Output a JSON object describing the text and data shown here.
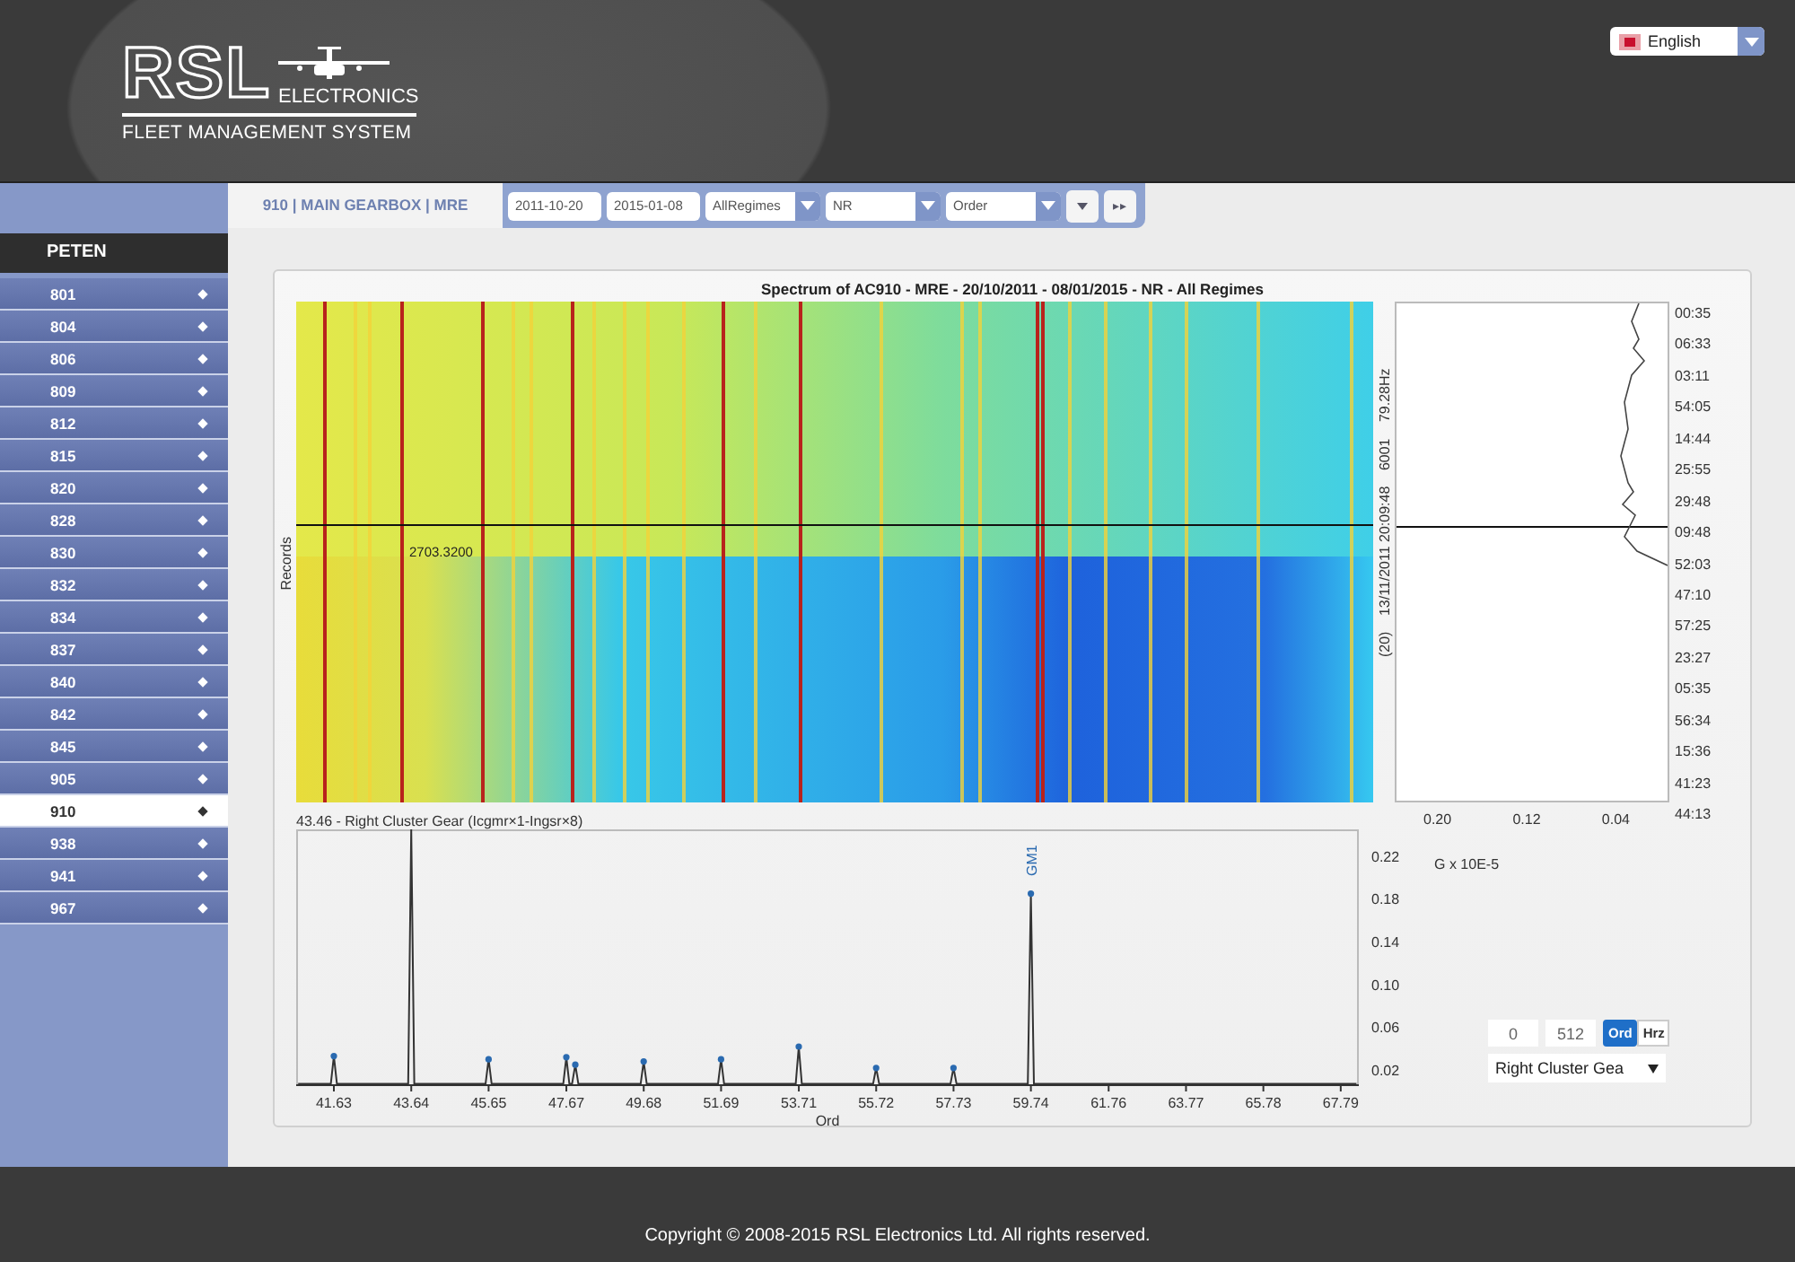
{
  "header": {
    "logo_text": "RSL",
    "logo_subtitle": "ELECTRONICS",
    "system_name": "FLEET MANAGEMENT SYSTEM",
    "language": "English"
  },
  "sidebar": {
    "title": "PETEN",
    "items": [
      {
        "label": "801",
        "selected": false
      },
      {
        "label": "804",
        "selected": false
      },
      {
        "label": "806",
        "selected": false
      },
      {
        "label": "809",
        "selected": false
      },
      {
        "label": "812",
        "selected": false
      },
      {
        "label": "815",
        "selected": false
      },
      {
        "label": "820",
        "selected": false
      },
      {
        "label": "828",
        "selected": false
      },
      {
        "label": "830",
        "selected": false
      },
      {
        "label": "832",
        "selected": false
      },
      {
        "label": "834",
        "selected": false
      },
      {
        "label": "837",
        "selected": false
      },
      {
        "label": "840",
        "selected": false
      },
      {
        "label": "842",
        "selected": false
      },
      {
        "label": "845",
        "selected": false
      },
      {
        "label": "905",
        "selected": false
      },
      {
        "label": "910",
        "selected": true
      },
      {
        "label": "938",
        "selected": false
      },
      {
        "label": "941",
        "selected": false
      },
      {
        "label": "967",
        "selected": false
      }
    ]
  },
  "tab": {
    "label": "910 | MAIN GEARBOX | MRE",
    "selected": true
  },
  "toolbar": {
    "start_date": "2011-10-20",
    "end_date": "2015-01-08",
    "selects": [
      "AllRegimes",
      "NR",
      "Order"
    ],
    "next_button": "▸▸"
  },
  "chart_card": {
    "title": "Spectrum of AC910 - MRE - 20/10/2011 - 08/01/2015 - NR - All Regimes",
    "records_label": "Records",
    "cursor_value": "2703.3200",
    "cursor_info": [
      "(20)",
      "13/11/2011 20:09:48",
      "6001",
      "79.28Hz"
    ],
    "trace_x_labels": [
      "0.20",
      "0.12",
      "0.04"
    ],
    "trace_times": [
      "00:35",
      "06:33",
      "03:11",
      "54:05",
      "14:44",
      "25:55",
      "29:48",
      "09:48",
      "52:03",
      "47:10",
      "57:25",
      "23:27",
      "05:35",
      "56:34",
      "15:36",
      "41:23",
      "44:13"
    ],
    "chart_data": {
      "type": "line",
      "title": "43.46 - Right Cluster Gear (Icgmr×1-Ingsr×8)",
      "xlabel": "Ord",
      "x": [
        40.7,
        41.55,
        41.63,
        41.71,
        43.56,
        43.64,
        43.72,
        45.57,
        45.65,
        45.73,
        47.59,
        47.67,
        47.75,
        47.82,
        47.9,
        47.98,
        49.6,
        49.68,
        49.76,
        51.61,
        51.69,
        51.77,
        53.63,
        53.71,
        53.79,
        55.64,
        55.72,
        55.8,
        57.65,
        57.73,
        57.81,
        59.66,
        59.74,
        59.82,
        68.2
      ],
      "series": [
        {
          "color": "#333333",
          "values": [
            0.007,
            0.007,
            0.033,
            0.007,
            0.007,
            0.245,
            0.007,
            0.007,
            0.03,
            0.007,
            0.007,
            0.032,
            0.007,
            0.007,
            0.025,
            0.007,
            0.007,
            0.028,
            0.007,
            0.007,
            0.03,
            0.007,
            0.007,
            0.042,
            0.007,
            0.007,
            0.022,
            0.007,
            0.007,
            0.022,
            0.007,
            0.007,
            0.185,
            0.007,
            0.007
          ]
        }
      ],
      "xlim": [
        40.65,
        68.26
      ],
      "ylim": [
        0.005,
        0.245
      ],
      "xticks": [
        41.63,
        43.64,
        45.65,
        47.67,
        49.68,
        51.69,
        53.71,
        55.72,
        57.73,
        59.74,
        61.76,
        63.77,
        65.78,
        67.79
      ],
      "yticks": [
        {
          "value": 0.02,
          "label": "0.02"
        },
        {
          "value": 0.06,
          "label": "0.06"
        },
        {
          "value": 0.1,
          "label": "0.10"
        },
        {
          "value": 0.14,
          "label": "0.14"
        },
        {
          "value": 0.18,
          "label": "0.18"
        },
        {
          "value": 0.22,
          "label": "0.22"
        }
      ],
      "annotations": [
        "GM1"
      ]
    },
    "unit": "G x 10E-5",
    "range_from": "0",
    "range_to": "512",
    "modes": [
      {
        "label": "Ord",
        "selected": true
      },
      {
        "label": "Hrz",
        "selected": false
      }
    ],
    "component_select": "Right Cluster Gea"
  },
  "footer": {
    "copyright": "Copyright © 2008-2015 RSL Electronics Ltd. All rights reserved."
  }
}
